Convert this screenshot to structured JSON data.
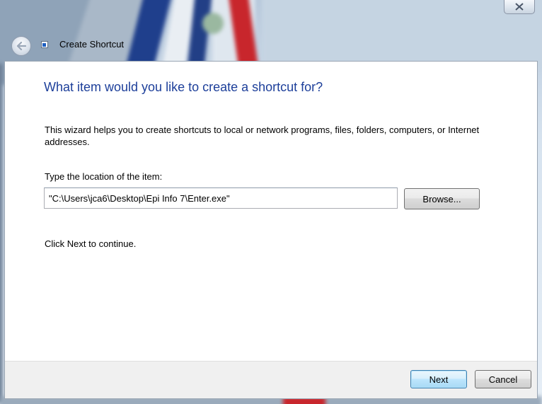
{
  "window": {
    "title": "Create Shortcut",
    "caption_buttons": {
      "close_icon": "close-x-icon"
    },
    "back_icon": "back-arrow-icon",
    "title_icon": "shortcut-icon"
  },
  "wizard": {
    "heading": "What item would you like to create a shortcut for?",
    "description": "This wizard helps you to create shortcuts to local or network programs, files, folders, computers, or Internet addresses.",
    "location_label": "Type the location of the item:",
    "location_value": "\"C:\\Users\\jca6\\Desktop\\Epi Info 7\\Enter.exe\"",
    "browse_label": "Browse...",
    "continue_text": "Click Next to continue."
  },
  "footer": {
    "next_label": "Next",
    "cancel_label": "Cancel"
  },
  "colors": {
    "heading": "#1d3f9a",
    "footer_bg": "#f0f0f0",
    "default_button_border": "#3c7fb1"
  }
}
